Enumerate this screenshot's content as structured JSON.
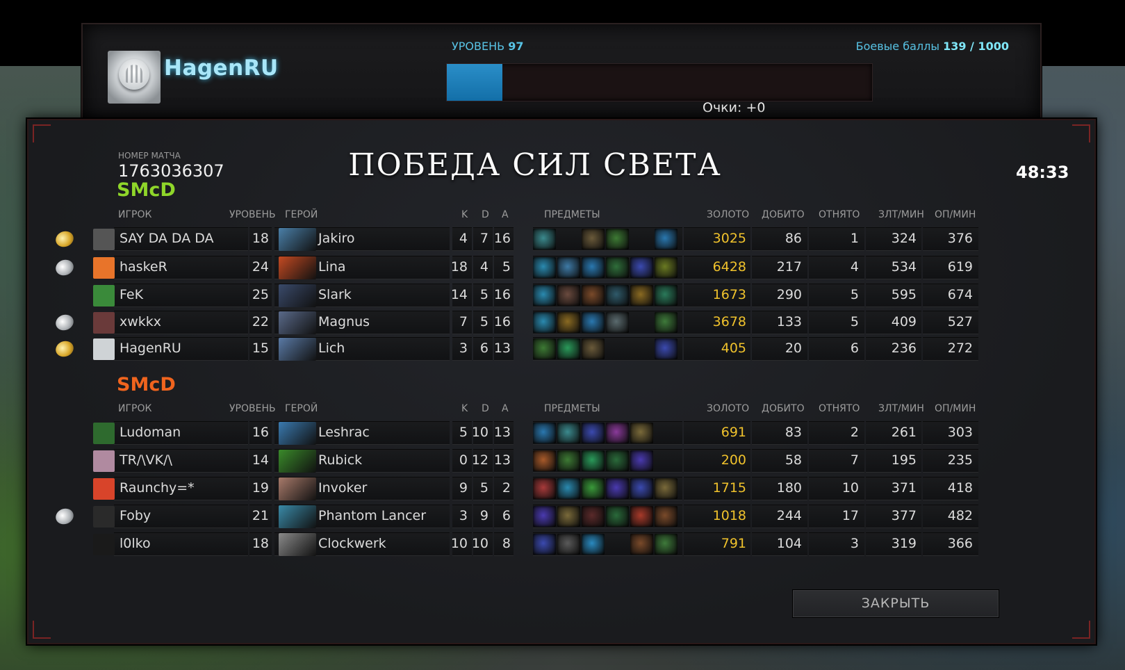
{
  "profile": {
    "name": "HagenRU",
    "level_label": "УРОВЕНЬ",
    "level_value": "97",
    "level_progress": 0.13,
    "points": "Очки: +0",
    "battle_label": "Боевые баллы",
    "battle_value": "139 / 1000"
  },
  "match": {
    "id_label": "НОМЕР МАТЧА",
    "id": "1763036307",
    "result": "ПОБЕДА СИЛ СВЕТА",
    "duration": "48:33"
  },
  "headers": {
    "player": "ИГРОК",
    "level": "УРОВЕНЬ",
    "hero": "ГЕРОЙ",
    "k": "K",
    "d": "D",
    "a": "A",
    "items": "ПРЕДМЕТЫ",
    "gold": "ЗОЛОТО",
    "lasthits": "ДОБИТО",
    "denies": "ОТНЯТО",
    "gpm": "ЗЛТ/МИН",
    "xpm": "ОП/МИН"
  },
  "teams": [
    {
      "name": "SMcD",
      "color": "#8fd62a",
      "players": [
        {
          "medal": "gold",
          "player": "SAY DA DA DA",
          "avatar_color": "#555555",
          "level": "18",
          "hero": "Jakiro",
          "hero_color": "#4a7fa8",
          "k": "4",
          "d": "7",
          "a": "16",
          "items": [
            "#3b8a8e",
            "",
            "#6a5a3a",
            "#3d7a34",
            "",
            "#2a78b0"
          ],
          "gold": "3025",
          "lasthits": "86",
          "denies": "1",
          "gpm": "324",
          "xpm": "376"
        },
        {
          "medal": "silver",
          "player": "haskeR",
          "avatar_color": "#e8742a",
          "level": "24",
          "hero": "Lina",
          "hero_color": "#c44a22",
          "k": "18",
          "d": "4",
          "a": "5",
          "items": [
            "#2a8ab0",
            "#3e7aa6",
            "#2a78b0",
            "#2f6e3a",
            "#3b4ab0",
            "#6a7a22"
          ],
          "gold": "6428",
          "lasthits": "217",
          "denies": "4",
          "gpm": "534",
          "xpm": "619"
        },
        {
          "medal": "",
          "player": "FeK",
          "avatar_color": "#3a8a3a",
          "level": "25",
          "hero": "Slark",
          "hero_color": "#3a4a6a",
          "k": "14",
          "d": "5",
          "a": "16",
          "items": [
            "#2a8ab0",
            "#6a4a3e",
            "#7a4a2a",
            "#2f5a6a",
            "#8a6a22",
            "#2a7a5a"
          ],
          "gold": "1673",
          "lasthits": "290",
          "denies": "5",
          "gpm": "595",
          "xpm": "674"
        },
        {
          "medal": "silver",
          "player": "xwkkx",
          "avatar_color": "#6a3a3a",
          "level": "22",
          "hero": "Magnus",
          "hero_color": "#5a6a8a",
          "k": "7",
          "d": "5",
          "a": "16",
          "items": [
            "#2a8ab0",
            "#8a6a22",
            "#2a78b0",
            "#5a6a6e",
            "",
            "#3e7a3a"
          ],
          "gold": "3678",
          "lasthits": "133",
          "denies": "5",
          "gpm": "409",
          "xpm": "527"
        },
        {
          "medal": "gold",
          "player": "HagenRU",
          "avatar_color": "#cfd3d6",
          "level": "15",
          "hero": "Lich",
          "hero_color": "#5a7aa6",
          "k": "3",
          "d": "6",
          "a": "13",
          "items": [
            "#3d7a34",
            "#2a9a5a",
            "#6a5a3a",
            "",
            "",
            "#3b4ab0"
          ],
          "gold": "405",
          "lasthits": "20",
          "denies": "6",
          "gpm": "236",
          "xpm": "272"
        }
      ]
    },
    {
      "name": "SMcD",
      "color": "#f0641e",
      "players": [
        {
          "medal": "",
          "player": "Ludoman",
          "avatar_color": "#2e6a2e",
          "level": "16",
          "hero": "Leshrac",
          "hero_color": "#3a7ab0",
          "k": "5",
          "d": "10",
          "a": "13",
          "items": [
            "#2a78b0",
            "#3b8a8e",
            "#3b4ab0",
            "#8a3a9a",
            "#7a6a3a",
            ""
          ],
          "gold": "691",
          "lasthits": "83",
          "denies": "2",
          "gpm": "261",
          "xpm": "303"
        },
        {
          "medal": "",
          "player": "TR/\\VK/\\",
          "avatar_color": "#b08aa0",
          "level": "14",
          "hero": "Rubick",
          "hero_color": "#3a8a2a",
          "k": "0",
          "d": "12",
          "a": "13",
          "items": [
            "#a85a2a",
            "#3d7a34",
            "#2a9a5a",
            "#2a6a3a",
            "#4a3ab0",
            ""
          ],
          "gold": "200",
          "lasthits": "58",
          "denies": "7",
          "gpm": "195",
          "xpm": "235"
        },
        {
          "medal": "",
          "player": "Raunchy=*",
          "avatar_color": "#d8442a",
          "level": "19",
          "hero": "Invoker",
          "hero_color": "#a87a6a",
          "k": "9",
          "d": "5",
          "a": "2",
          "items": [
            "#a83a3a",
            "#2a8ab0",
            "#3a9a3a",
            "#4a3ab0",
            "#3b4ab0",
            "#7a6a3a"
          ],
          "gold": "1715",
          "lasthits": "180",
          "denies": "10",
          "gpm": "371",
          "xpm": "418"
        },
        {
          "medal": "silver",
          "player": "Foby",
          "avatar_color": "#2a2a2a",
          "level": "21",
          "hero": "Phantom Lancer",
          "hero_color": "#3a8aa8",
          "k": "3",
          "d": "9",
          "a": "6",
          "items": [
            "#4a3ab0",
            "#7a6a3a",
            "#5a2a2a",
            "#2a6a3a",
            "#a83a2a",
            "#7a4a2a"
          ],
          "gold": "1018",
          "lasthits": "244",
          "denies": "17",
          "gpm": "377",
          "xpm": "482"
        },
        {
          "medal": "",
          "player": "l0lko",
          "avatar_color": "#1a1a1a",
          "level": "18",
          "hero": "Clockwerk",
          "hero_color": "#8a8a8a",
          "k": "10",
          "d": "10",
          "a": "8",
          "items": [
            "#3b4ab0",
            "#5a5a5a",
            "#2a8ac0",
            "",
            "#7a4a2a",
            "#3e7a3a"
          ],
          "gold": "791",
          "lasthits": "104",
          "denies": "3",
          "gpm": "319",
          "xpm": "366"
        }
      ]
    }
  ],
  "buttons": {
    "close": "ЗАКРЫТЬ"
  }
}
